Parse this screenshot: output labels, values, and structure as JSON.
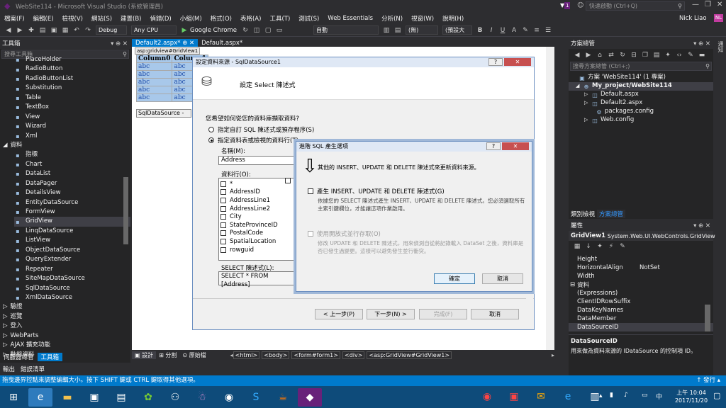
{
  "window": {
    "title": "WebSite114 - Microsoft Visual Studio (系統管理員)",
    "quick_launch": "快速啟動 (Ctrl+Q)",
    "notification_count": "1",
    "user": "Nick Liao",
    "user_initials": "NL"
  },
  "menu": [
    "檔案(F)",
    "編輯(E)",
    "檢視(V)",
    "網站(S)",
    "建置(B)",
    "偵錯(D)",
    "小組(M)",
    "格式(O)",
    "表格(A)",
    "工具(T)",
    "測試(S)",
    "Web Essentials",
    "分析(N)",
    "視窗(W)",
    "說明(H)"
  ],
  "toolbar": {
    "config": "Debug",
    "platform": "Any CPU",
    "browser": "Google Chrome",
    "zoom": "自動",
    "block": "(無)",
    "font": "(預設大",
    "bold": "B",
    "italic": "I",
    "underline": "U"
  },
  "toolbox": {
    "title": "工具箱",
    "search": "搜尋工具箱",
    "items": [
      "PlaceHolder",
      "RadioButton",
      "RadioButtonList",
      "Substitution",
      "Table",
      "TextBox",
      "View",
      "Wizard",
      "Xml"
    ],
    "data_group": "資料",
    "data_items": [
      "指標",
      "Chart",
      "DataList",
      "DataPager",
      "DetailsView",
      "EntityDataSource",
      "FormView",
      "GridView",
      "LinqDataSource",
      "ListView",
      "ObjectDataSource",
      "QueryExtender",
      "Repeater",
      "SiteMapDataSource",
      "SqlDataSource",
      "XmlDataSource"
    ],
    "groups": [
      "驗證",
      "巡覽",
      "登入",
      "WebParts",
      "AJAX 擴充功能",
      "動態資料"
    ],
    "bottom_tabs": [
      "伺服器總管",
      "工具箱"
    ]
  },
  "doc_tabs": [
    {
      "label": "Default2.aspx*",
      "active": true
    },
    {
      "label": "Default.aspx*",
      "active": false
    }
  ],
  "designer": {
    "tag": "asp:gridview#GridView1",
    "columns": [
      "Column0",
      "Column1"
    ],
    "cell": "abc",
    "rows": 5,
    "datasource": "SqlDataSource - Sql"
  },
  "wizard": {
    "title": "設定資料來源 - SqlDataSource1",
    "heading": "設定 Select 陳述式",
    "question": "您希望如何從您的資料庫擷取資料?",
    "opt1": "指定自訂 SQL 陳述式或預存程序(S)",
    "opt2": "指定資料表或檢視的資料行(T)",
    "name_label": "名稱(M):",
    "name_value": "Address",
    "cols_label": "資料行(O):",
    "columns": [
      "*",
      "AddressID",
      "AddressLine1",
      "AddressLine2",
      "City",
      "StateProvinceID",
      "PostalCode",
      "SpatialLocation",
      "rowguid"
    ],
    "select_label": "SELECT 陳述式(L):",
    "select_value": "SELECT * FROM [Address]",
    "btn_prev": "< 上一步(P)",
    "btn_next": "下一步(N) >",
    "btn_finish": "完成(F)",
    "btn_cancel": "取消"
  },
  "adv": {
    "title": "進階 SQL 產生選項",
    "desc": "其他的 INSERT、UPDATE 和 DELETE 陳述式來更新資料來源。",
    "chk1": "產生 INSERT、UPDATE 和 DELETE 陳述式(G)",
    "chk1_desc": "依據您的 SELECT 陳述式產生 INSERT、UPDATE 和 DELETE 陳述式。您必須選取所有主索引鍵欄位，才能讓這項作業啟用。",
    "chk2": "使用開放式並行存取(O)",
    "chk2_desc": "修改 UPDATE 和 DELETE 陳述式，用來偵測自從將記錄載入 DataSet 之後，資料庫是否已發生過變更。這樣可以避免發生並行衝突。",
    "ok": "確定",
    "cancel": "取消"
  },
  "bottom_bar": {
    "design": "設計",
    "split": "分割",
    "source": "原始檔",
    "crumbs": [
      "<html>",
      "<body>",
      "<form#form1>",
      "<div>",
      "<asp:GridView#GridView1>"
    ]
  },
  "output_tabs": [
    "輸出",
    "錯誤清單"
  ],
  "solution": {
    "title": "方案總管",
    "search": "搜尋方案總管 (Ctrl+;)",
    "items": [
      "方案 'WebSite114' (1 專案)",
      "My_project/WebSite114",
      "Default.aspx",
      "Default2.aspx",
      "packages.config",
      "Web.config"
    ],
    "tabs": [
      "類別檢視",
      "方案總管"
    ]
  },
  "properties": {
    "title": "屬性",
    "object": "GridView1",
    "type": "System.Web.UI.WebControls.GridView",
    "rows": [
      {
        "name": "Height",
        "value": ""
      },
      {
        "name": "HorizontalAlign",
        "value": "NotSet"
      },
      {
        "name": "Width",
        "value": ""
      }
    ],
    "group": "資料",
    "data_rows": [
      "(Expressions)",
      "ClientIDRowSuffix",
      "DataKeyNames",
      "DataMember",
      "DataSourceID"
    ],
    "desc_title": "DataSourceID",
    "desc": "用來做為資料來源的 IDataSource 的控制項 ID。"
  },
  "status": {
    "text": "拖曳邊界控點來調整編輯大小。按下 SHIFT 鍵或 CTRL 鍵取得其他選項。",
    "publish": "發行"
  },
  "taskbar": {
    "time": "上午 10:04",
    "date": "2017/11/20",
    "lang": "中"
  },
  "side_label": "通知"
}
